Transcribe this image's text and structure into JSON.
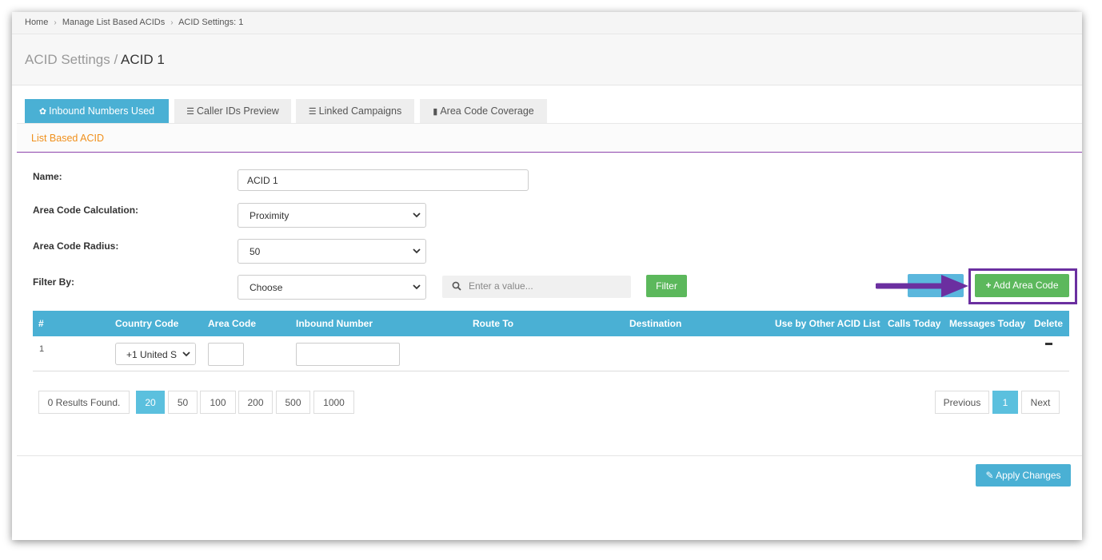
{
  "breadcrumb": {
    "items": [
      "Home",
      "Manage List Based ACIDs",
      "ACID Settings: 1"
    ]
  },
  "header": {
    "parent": "ACID Settings",
    "separator": "/",
    "current": "ACID 1"
  },
  "tabs": [
    {
      "label": "Inbound Numbers Used",
      "icon": "gear-icon",
      "active": true
    },
    {
      "label": "Caller IDs Preview",
      "icon": "list-icon",
      "active": false
    },
    {
      "label": "Linked Campaigns",
      "icon": "list-icon",
      "active": false
    },
    {
      "label": "Area Code Coverage",
      "icon": "file-icon",
      "active": false
    }
  ],
  "section": {
    "title": "List Based ACID"
  },
  "form": {
    "name_label": "Name:",
    "name_value": "ACID 1",
    "calc_label": "Area Code Calculation:",
    "calc_value": "Proximity",
    "radius_label": "Area Code Radius:",
    "radius_value": "50",
    "filter_label": "Filter By:",
    "filter_value": "Choose",
    "search_placeholder": "Enter a value...",
    "filter_button": "Filter",
    "add_button": "Add Area Code"
  },
  "table": {
    "columns": [
      "#",
      "Country Code",
      "Area Code",
      "Inbound Number",
      "Route To",
      "Destination",
      "Use by Other ACID List",
      "Calls Today",
      "Messages Today",
      "Delete"
    ],
    "rows": [
      {
        "num": "1",
        "country_code": "+1 United S",
        "area_code": "",
        "inbound_number": ""
      }
    ]
  },
  "pagination": {
    "results": "0 Results Found.",
    "page_sizes": [
      "20",
      "50",
      "100",
      "200",
      "500",
      "1000"
    ],
    "selected_size": "20",
    "previous": "Previous",
    "current_page": "1",
    "next": "Next"
  },
  "footer": {
    "apply_button": "Apply Changes"
  },
  "colors": {
    "accent": "#4ab0d4",
    "green": "#5cb85c",
    "orange": "#f0901c",
    "highlight": "#6b2fa0"
  }
}
